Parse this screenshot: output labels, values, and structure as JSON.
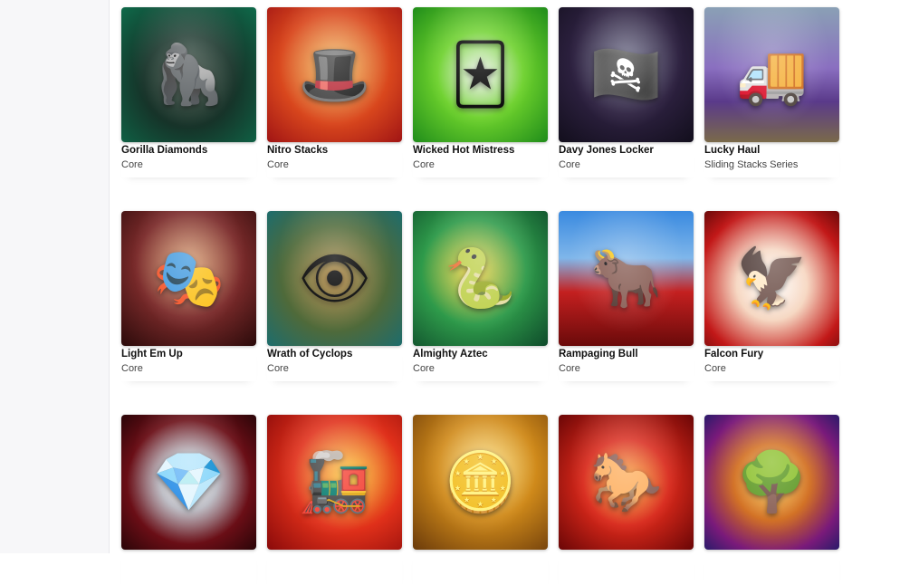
{
  "games": [
    {
      "title": "Gorilla Diamonds",
      "category": "Core",
      "icon": "gorilla-icon",
      "glyph": "🦍"
    },
    {
      "title": "Nitro Stacks",
      "category": "Core",
      "icon": "ringmaster-icon",
      "glyph": "🎩"
    },
    {
      "title": "Wicked Hot Mistress",
      "category": "Core",
      "icon": "jester-icon",
      "glyph": "🃏"
    },
    {
      "title": "Davy Jones Locker",
      "category": "Core",
      "icon": "pirate-icon",
      "glyph": "🏴‍☠️"
    },
    {
      "title": "Lucky Haul",
      "category": "Sliding Stacks Series",
      "icon": "truck-icon",
      "glyph": "🚚"
    },
    {
      "title": "Light Em Up",
      "category": "Core",
      "icon": "masked-woman-icon",
      "glyph": "🎭"
    },
    {
      "title": "Wrath of Cyclops",
      "category": "Core",
      "icon": "cyclops-icon",
      "glyph": "👁"
    },
    {
      "title": "Almighty Aztec",
      "category": "Core",
      "icon": "serpent-icon",
      "glyph": "🐍"
    },
    {
      "title": "Rampaging Bull",
      "category": "Core",
      "icon": "bull-icon",
      "glyph": "🐂"
    },
    {
      "title": "Falcon Fury",
      "category": "Core",
      "icon": "falcon-icon",
      "glyph": "🦅"
    },
    {
      "title": "",
      "category": "",
      "icon": "diamond-icon",
      "glyph": "💎"
    },
    {
      "title": "",
      "category": "",
      "icon": "train-icon",
      "glyph": "🚂"
    },
    {
      "title": "",
      "category": "",
      "icon": "gold-cart-icon",
      "glyph": "🪙"
    },
    {
      "title": "",
      "category": "",
      "icon": "fire-horse-icon",
      "glyph": "🐎"
    },
    {
      "title": "",
      "category": "",
      "icon": "golden-tree-icon",
      "glyph": "🌳"
    }
  ]
}
